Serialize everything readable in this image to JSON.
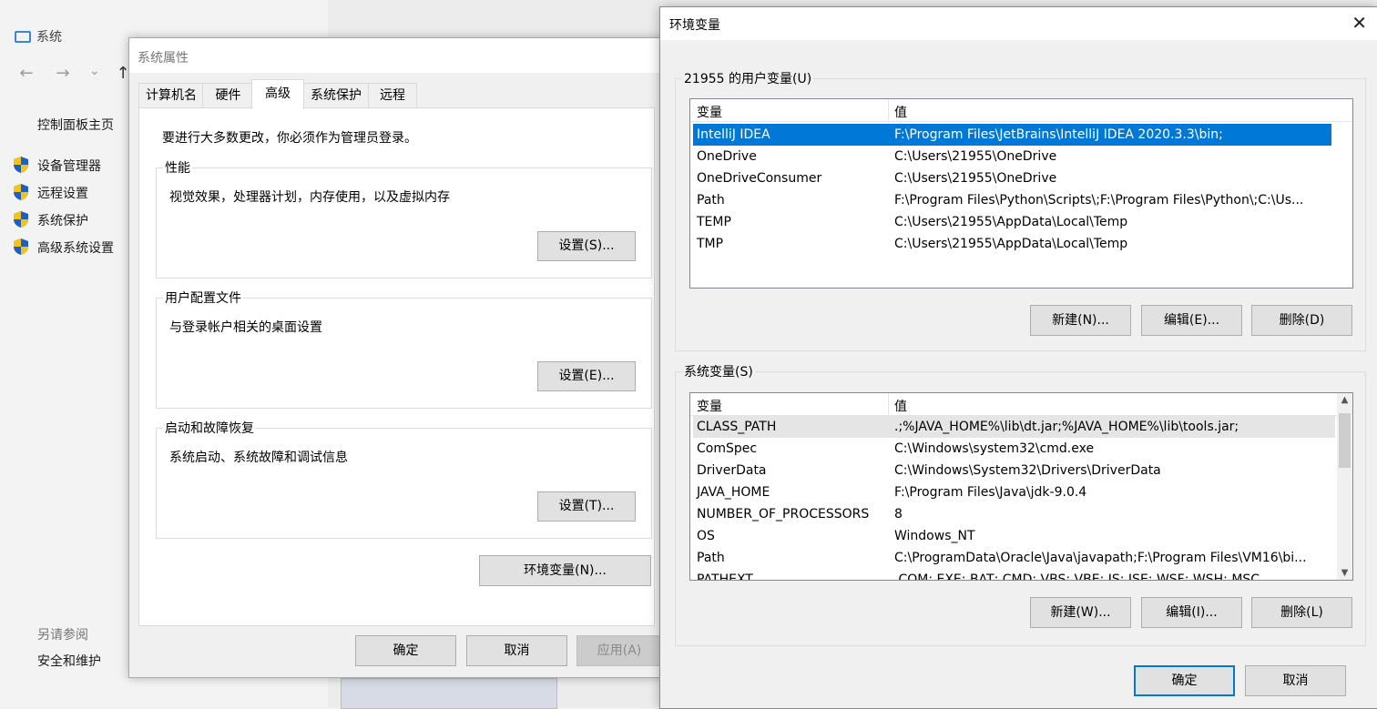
{
  "system_window": {
    "title": "系统",
    "nav": {
      "back": "←",
      "forward": "→",
      "dropdown": "⌄",
      "up": "↑"
    },
    "home_link": "控制面板主页",
    "links": [
      "设备管理器",
      "远程设置",
      "系统保护",
      "高级系统设置"
    ],
    "see_also_heading": "另请参阅",
    "see_also_link": "安全和维护"
  },
  "system_properties": {
    "title": "系统属性",
    "tabs": [
      "计算机名",
      "硬件",
      "高级",
      "系统保护",
      "远程"
    ],
    "active_tab": "高级",
    "admin_note": "要进行大多数更改，你必须作为管理员登录。",
    "performance": {
      "heading": "性能",
      "desc": "视觉效果，处理器计划，内存使用，以及虚拟内存",
      "button": "设置(S)..."
    },
    "user_profiles": {
      "heading": "用户配置文件",
      "desc": "与登录帐户相关的桌面设置",
      "button": "设置(E)..."
    },
    "startup_recovery": {
      "heading": "启动和故障恢复",
      "desc": "系统启动、系统故障和调试信息",
      "button": "设置(T)..."
    },
    "env_button": "环境变量(N)...",
    "ok": "确定",
    "cancel": "取消",
    "apply": "应用(A)"
  },
  "env_vars": {
    "title": "环境变量",
    "close": "✕",
    "user_section": {
      "heading": "21955 的用户变量(U)",
      "col_var": "变量",
      "col_val": "值",
      "rows": [
        {
          "name": "IntelliJ IDEA",
          "value": "F:\\Program Files\\JetBrains\\IntelliJ IDEA 2020.3.3\\bin;"
        },
        {
          "name": "OneDrive",
          "value": "C:\\Users\\21955\\OneDrive"
        },
        {
          "name": "OneDriveConsumer",
          "value": "C:\\Users\\21955\\OneDrive"
        },
        {
          "name": "Path",
          "value": "F:\\Program Files\\Python\\Scripts\\;F:\\Program Files\\Python\\;C:\\Us..."
        },
        {
          "name": "TEMP",
          "value": "C:\\Users\\21955\\AppData\\Local\\Temp"
        },
        {
          "name": "TMP",
          "value": "C:\\Users\\21955\\AppData\\Local\\Temp"
        }
      ],
      "selected_row": "IntelliJ IDEA",
      "btn_new": "新建(N)...",
      "btn_edit": "编辑(E)...",
      "btn_delete": "删除(D)"
    },
    "system_section": {
      "heading": "系统变量(S)",
      "col_var": "变量",
      "col_val": "值",
      "rows": [
        {
          "name": "CLASS_PATH",
          "value": ".;%JAVA_HOME%\\lib\\dt.jar;%JAVA_HOME%\\lib\\tools.jar;"
        },
        {
          "name": "ComSpec",
          "value": "C:\\Windows\\system32\\cmd.exe"
        },
        {
          "name": "DriverData",
          "value": "C:\\Windows\\System32\\Drivers\\DriverData"
        },
        {
          "name": "JAVA_HOME",
          "value": "F:\\Program Files\\Java\\jdk-9.0.4"
        },
        {
          "name": "NUMBER_OF_PROCESSORS",
          "value": "8"
        },
        {
          "name": "OS",
          "value": "Windows_NT"
        },
        {
          "name": "Path",
          "value": "C:\\ProgramData\\Oracle\\Java\\javapath;F:\\Program Files\\VM16\\bi..."
        },
        {
          "name": "PATHEXT",
          "value": ".COM;.EXE;.BAT;.CMD;.VBS;.VBE;.JS;.JSE;.WSF;.WSH;.MSC"
        }
      ],
      "highlighted_row": "CLASS_PATH",
      "btn_new": "新建(W)...",
      "btn_edit": "编辑(I)...",
      "btn_delete": "删除(L)"
    },
    "ok": "确定",
    "cancel": "取消"
  },
  "colors": {
    "selection": "#0078d7",
    "shield_blue": "#1f5fbf",
    "shield_yellow": "#f3c31b"
  }
}
